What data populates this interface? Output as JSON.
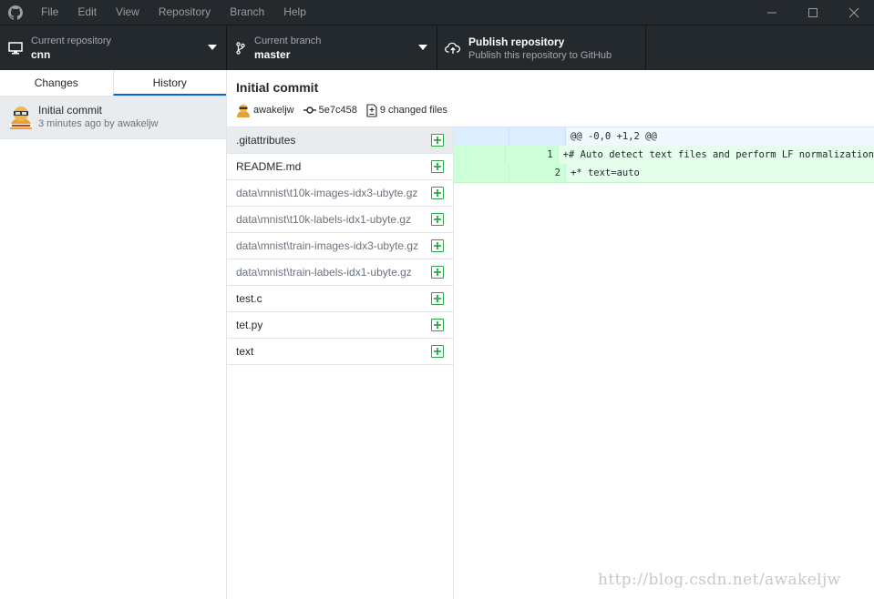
{
  "menu": [
    "File",
    "Edit",
    "View",
    "Repository",
    "Branch",
    "Help"
  ],
  "toolbar": {
    "repo_label": "Current repository",
    "repo_value": "cnn",
    "branch_label": "Current branch",
    "branch_value": "master",
    "publish_title": "Publish repository",
    "publish_sub": "Publish this repository to GitHub"
  },
  "sidebar": {
    "tabs": [
      "Changes",
      "History"
    ],
    "selected_tab": "History",
    "commit": {
      "title": "Initial commit",
      "meta": "3 minutes ago by awakeljw"
    }
  },
  "commit_header": {
    "title": "Initial commit",
    "author": "awakeljw",
    "sha": "5e7c458",
    "changed_files": "9 changed files"
  },
  "files": [
    {
      "dir": "",
      "name": ".gitattributes"
    },
    {
      "dir": "",
      "name": "README.md"
    },
    {
      "dir": "data\\mnist\\",
      "name": "t10k-images-idx3-ubyte.gz"
    },
    {
      "dir": "data\\mnist\\",
      "name": "t10k-labels-idx1-ubyte.gz"
    },
    {
      "dir": "data\\mnist\\",
      "name": "train-images-idx3-ubyte.gz"
    },
    {
      "dir": "data\\mnist\\",
      "name": "train-labels-idx1-ubyte.gz"
    },
    {
      "dir": "",
      "name": "test.c"
    },
    {
      "dir": "",
      "name": "tet.py"
    },
    {
      "dir": "",
      "name": "text"
    }
  ],
  "diff": {
    "hunk": "@@ -0,0 +1,2 @@",
    "lines": [
      {
        "old": "",
        "new": "1",
        "text": "+# Auto detect text files and perform LF normalization"
      },
      {
        "old": "",
        "new": "2",
        "text": "+* text=auto"
      }
    ]
  },
  "watermark": "http://blog.csdn.net/awakeljw",
  "colors": {
    "titlebar": "#24292e",
    "accent": "#0366d6",
    "added": "#28a745"
  }
}
